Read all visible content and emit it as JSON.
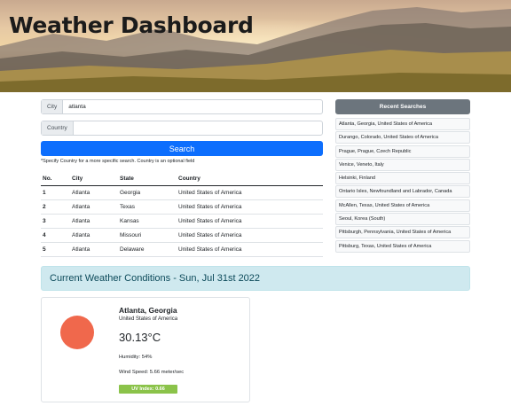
{
  "header": {
    "title": "Weather Dashboard"
  },
  "search": {
    "city_label": "City",
    "city_value": "atlanta",
    "country_label": "Country",
    "country_value": "",
    "button_label": "Search",
    "hint": "*Specify Country for a more specific search. Country is an optional field"
  },
  "results": {
    "headers": [
      "No.",
      "City",
      "State",
      "Country"
    ],
    "rows": [
      [
        "1",
        "Atlanta",
        "Georgia",
        "United States of America"
      ],
      [
        "2",
        "Atlanta",
        "Texas",
        "United States of America"
      ],
      [
        "3",
        "Atlanta",
        "Kansas",
        "United States of America"
      ],
      [
        "4",
        "Atlanta",
        "Missouri",
        "United States of America"
      ],
      [
        "5",
        "Atlanta",
        "Delaware",
        "United States of America"
      ]
    ]
  },
  "recent": {
    "title": "Recent Searches",
    "items": [
      "Atlanta, Georgia, United States of America",
      "Durango, Colorado, United States of America",
      "Prague, Prague, Czech Republic",
      "Venice, Veneto, Italy",
      "Helsinki, Finland",
      "Ontario Isles, Newfoundland and Labrador, Canada",
      "McAllen, Texas, United States of America",
      "Seoul, Korea (South)",
      "Pittsburgh, Pennsylvania, United States of America",
      "Pittsburg, Texas, United States of America"
    ]
  },
  "current": {
    "banner": "Current Weather Conditions - Sun, Jul 31st 2022",
    "city": "Atlanta, Georgia",
    "country": "United States of America",
    "temperature": "30.13°C",
    "humidity": "Humidity: 54%",
    "wind": "Wind Speed: 5.66 meter/sec",
    "uv": "UV Index: 0.66",
    "icon": "sun-icon",
    "icon_color": "#f0684c",
    "uv_color": "#8bc34a"
  },
  "colors": {
    "primary": "#0d6efd",
    "recent_header": "#6c757d",
    "banner_bg": "#cfe9ef"
  }
}
